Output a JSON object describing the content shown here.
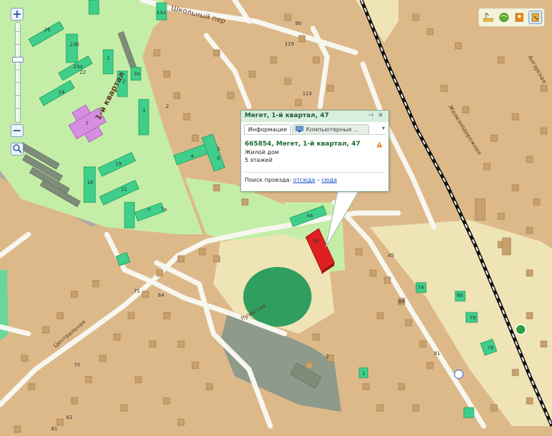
{
  "map": {
    "streets": {
      "shkolny": "Школьный пер",
      "kvartal": "1-й квартал",
      "zheleznodorozhnaya": "Железнодорожная",
      "angarskaya": "Ангарская",
      "tsentralnaya": "Центральная",
      "luchistaya": "Лучистая"
    },
    "house_numbers": {
      "h26": "26",
      "h23b": "23б",
      "h23a": "23а",
      "h22": "22",
      "h24": "24",
      "h1": "1",
      "h2": "2",
      "h3a": "3а",
      "h3": "3",
      "h5": "5",
      "h7": "7",
      "h4": "4",
      "h6": "6",
      "h19": "19",
      "h18": "18",
      "h21": "21",
      "h7b": "7",
      "h7a": "7а",
      "h13a": "13а",
      "h119": "119",
      "h113": "113",
      "h2b": "2",
      "h90": "90",
      "h44": "44",
      "h45": "45",
      "h71": "71",
      "h64": "64",
      "h70": "70",
      "h62": "62",
      "h61": "61",
      "h89": "89",
      "h74": "74",
      "h80": "80",
      "h78": "78",
      "h76": "76",
      "h81": "81",
      "h1b": "1",
      "h2c": "2",
      "h66": "6б"
    }
  },
  "zoom": {
    "plus": "+",
    "minus": "−"
  },
  "popup": {
    "title": "Мегет, 1-й квартал, 47",
    "tab_info": "Информация",
    "tab_computer": "Компьютерные ...",
    "address": "665854, Мегет, 1-й квартал, 47",
    "building_type": "Жилой дом",
    "floors": "5 этажей",
    "route_label": "Поиск проезда:",
    "route_from": "отсюда",
    "route_dash": "–",
    "route_to": "сюда"
  },
  "tools": [
    "ruler-icon",
    "globe-icon",
    "layers-icon",
    "select-icon"
  ],
  "colors": {
    "ground": "#ddb98a",
    "park": "#c4eea8",
    "building": "#3fcf8a",
    "selected_building": "#e02020",
    "highlight_building": "#d58ee0",
    "road": "#f7f7f0",
    "industrial": "#8e9a8a",
    "railway": "#111111"
  }
}
